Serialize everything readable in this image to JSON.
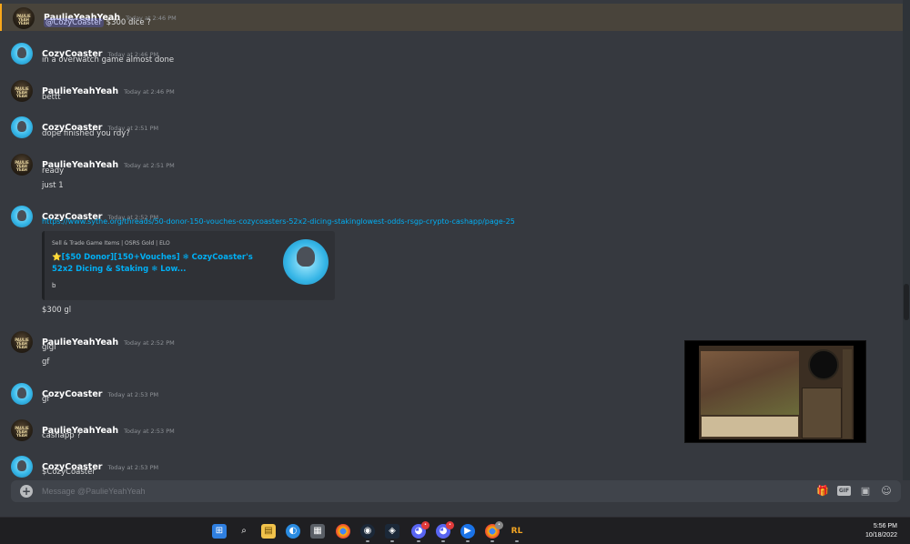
{
  "messages": [
    {
      "author": "PaulieYeahYeah",
      "avatar": "dark",
      "time": "Today at 2:46 PM",
      "mention": "@CozyCoaster",
      "text": "$300 dice ?"
    },
    {
      "author": "CozyCoaster",
      "avatar": "cyan",
      "time": "Today at 2:46 PM",
      "lines": [
        "in a overwatch game almost done"
      ]
    },
    {
      "author": "PaulieYeahYeah",
      "avatar": "dark",
      "time": "Today at 2:46 PM",
      "lines": [
        "bettt"
      ]
    },
    {
      "author": "CozyCoaster",
      "avatar": "cyan",
      "time": "Today at 2:51 PM",
      "lines": [
        "dope finished you rdy?"
      ]
    },
    {
      "author": "PaulieYeahYeah",
      "avatar": "dark",
      "time": "Today at 2:51 PM",
      "lines": [
        "ready",
        "just 1"
      ]
    },
    {
      "author": "CozyCoaster",
      "avatar": "cyan",
      "time": "Today at 2:52 PM",
      "link": "https://www.sythe.org/threads/50-donor-150-vouches-cozycoasters-52x2-dicing-stakinglowest-odds-rsgp-crypto-cashapp/page-25",
      "after": "$300 gl"
    },
    {
      "author": "PaulieYeahYeah",
      "avatar": "dark",
      "time": "Today at 2:52 PM",
      "lines": [
        "glgl",
        "gf"
      ]
    },
    {
      "author": "CozyCoaster",
      "avatar": "cyan",
      "time": "Today at 2:53 PM",
      "lines": [
        "gf"
      ]
    },
    {
      "author": "PaulieYeahYeah",
      "avatar": "dark",
      "time": "Today at 2:53 PM",
      "lines": [
        "cashapp ?"
      ]
    },
    {
      "author": "CozyCoaster",
      "avatar": "cyan",
      "time": "Today at 2:53 PM",
      "lines": [
        "$CozyCoaster"
      ]
    }
  ],
  "embed": {
    "provider": "Sell & Trade Game Items | OSRS Gold | ELO",
    "title": "⭐[$50 Donor][150+Vouches] ❄ CozyCoaster's 52x2 Dicing & Staking ❄ Low...",
    "description": "b"
  },
  "avatar_text": "PAULIE YEAH YEAH",
  "composer": {
    "placeholder": "Message @PaulieYeahYeah",
    "gif_label": "GIF"
  },
  "taskbar": {
    "icons": [
      "windows-start",
      "search",
      "file-explorer",
      "app-blue",
      "calculator",
      "chrome",
      "steam",
      "steam-alt",
      "discord",
      "discord-alt",
      "app-play",
      "chrome-alt",
      "runelite"
    ],
    "time": "5:56 PM",
    "date": "10/18/2022"
  },
  "colors": {
    "link": "#00aff4",
    "mention_bar": "#faa81a",
    "background": "#36393f"
  }
}
